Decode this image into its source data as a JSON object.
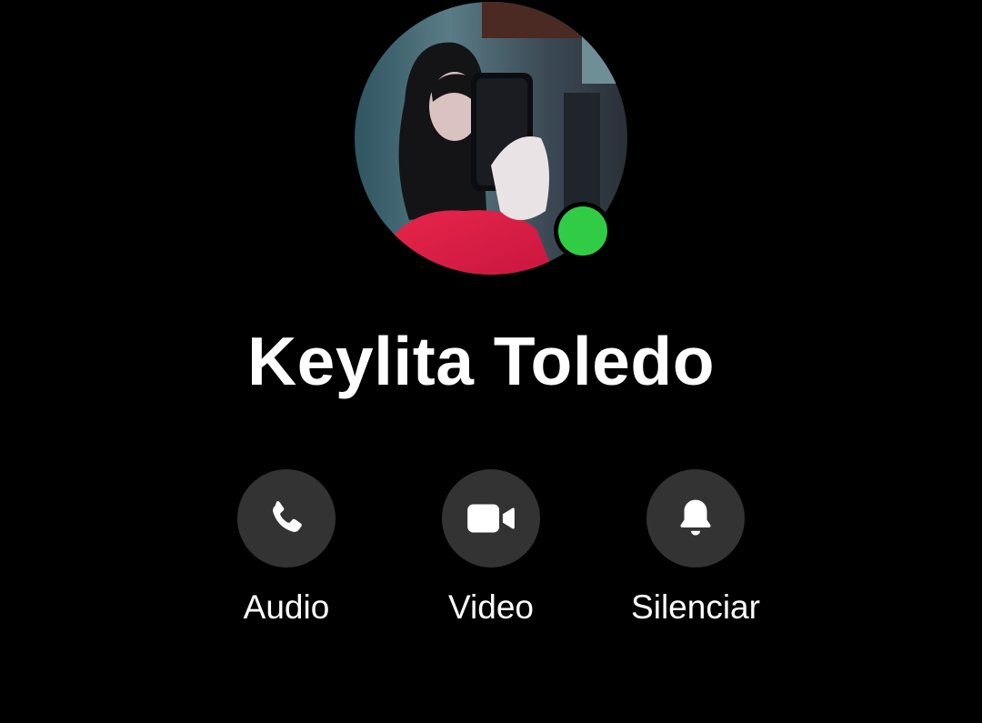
{
  "contact": {
    "name": "Keylita Toledo",
    "presence_color": "#31cc46",
    "avatar_icon": "profile-photo"
  },
  "actions": [
    {
      "label": "Audio",
      "icon": "phone-icon"
    },
    {
      "label": "Video",
      "icon": "video-camera-icon"
    },
    {
      "label": "Silenciar",
      "icon": "bell-icon"
    }
  ],
  "theme": {
    "background": "#000000",
    "button_bg": "#333333",
    "text": "#ffffff"
  }
}
